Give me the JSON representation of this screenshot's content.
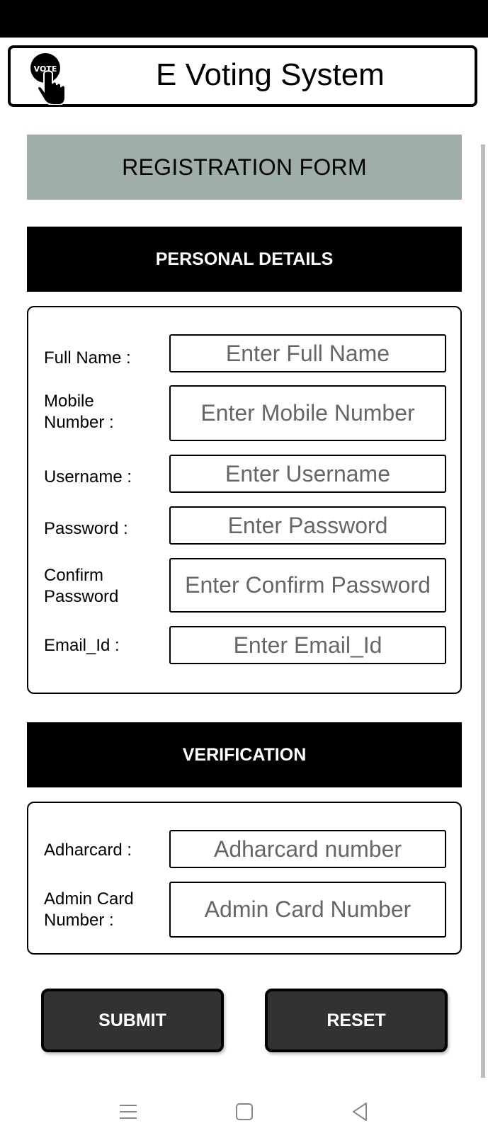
{
  "app": {
    "title": "E Voting System",
    "logo_text": "VOTE",
    "icon": "vote-hand-icon"
  },
  "form": {
    "title": "REGISTRATION FORM"
  },
  "personal": {
    "header": "PERSONAL DETAILS",
    "fields": [
      {
        "label": "Full Name :",
        "placeholder": "Enter Full Name",
        "value": ""
      },
      {
        "label": "Mobile\nNumber :",
        "placeholder": "Enter Mobile Number",
        "value": ""
      },
      {
        "label": "Username :",
        "placeholder": "Enter Username",
        "value": ""
      },
      {
        "label": "Password :",
        "placeholder": "Enter Password",
        "value": ""
      },
      {
        "label": "Confirm\nPassword",
        "placeholder": "Enter Confirm Password",
        "value": ""
      },
      {
        "label": "Email_Id :",
        "placeholder": "Enter Email_Id",
        "value": ""
      }
    ]
  },
  "verification": {
    "header": "VERIFICATION",
    "fields": [
      {
        "label": "Adharcard :",
        "placeholder": "Adharcard number",
        "value": ""
      },
      {
        "label": "Admin Card\nNumber :",
        "placeholder": "Admin Card Number",
        "value": ""
      }
    ]
  },
  "actions": {
    "submit": "SUBMIT",
    "reset": "RESET"
  },
  "navigation": {
    "icons": [
      "menu-icon",
      "home-square-icon",
      "back-triangle-icon"
    ]
  },
  "colors": {
    "title_bar": "#9fadab",
    "section_bar": "#000000",
    "button": "#303332"
  }
}
